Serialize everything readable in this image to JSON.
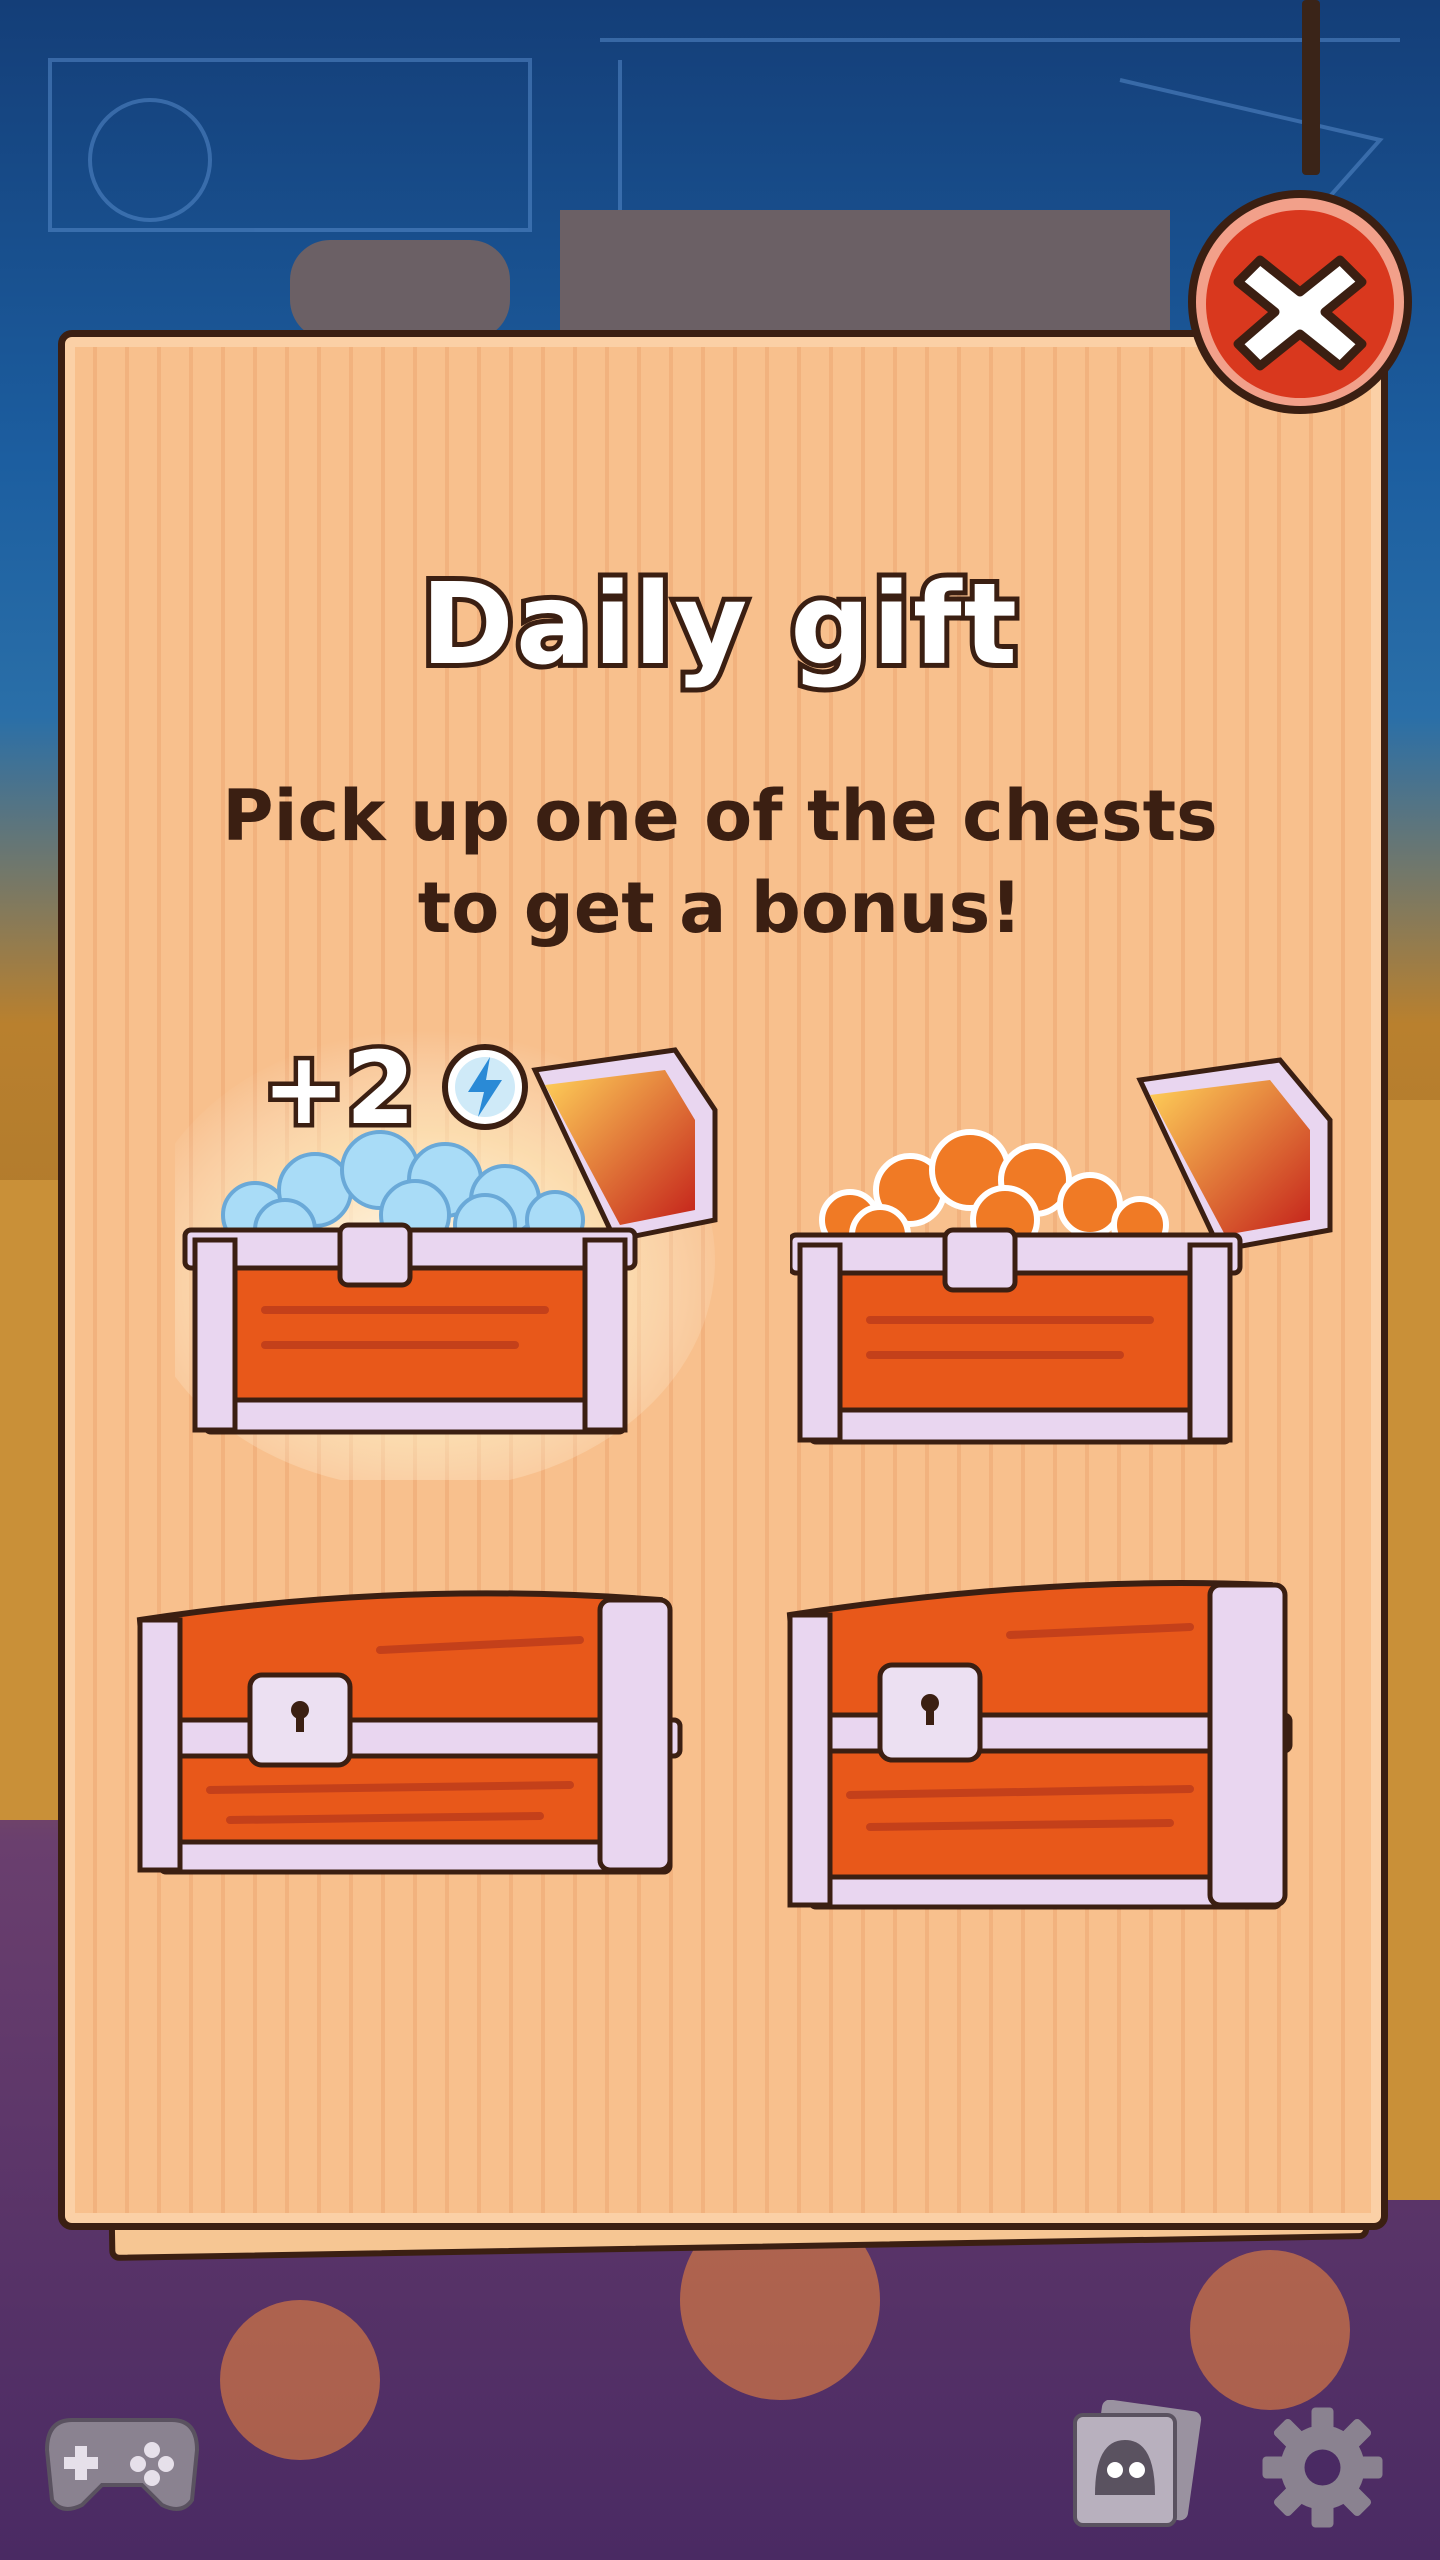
{
  "dialog": {
    "title": "Daily gift",
    "subtitle_line1": "Pick up one of the chests",
    "subtitle_line2": "to get a bonus!"
  },
  "chests": [
    {
      "state": "opened",
      "reward_label": "+2",
      "reward_icon": "lightning-bolt-icon",
      "contents": "energy-coins",
      "highlighted": true
    },
    {
      "state": "opened",
      "contents": "candies"
    },
    {
      "state": "closed"
    },
    {
      "state": "closed"
    }
  ],
  "controls": {
    "close_icon": "close-x-icon",
    "bottom_left_icon": "gamepad-icon",
    "bottom_mid_icon": "character-cards-icon",
    "bottom_right_icon": "gear-icon"
  },
  "colors": {
    "panel": "#f8c08d",
    "outline": "#3b1f12",
    "chest_orange": "#e8581a",
    "chest_trim": "#e9d6f0",
    "close_red": "#d9381e"
  }
}
